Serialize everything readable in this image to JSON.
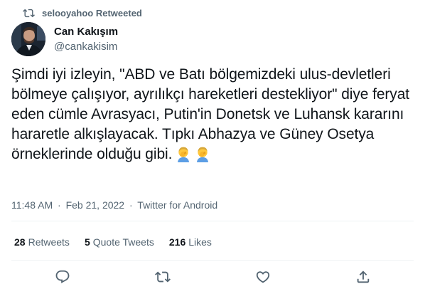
{
  "context": {
    "text": "selooyahoo Retweeted"
  },
  "author": {
    "name": "Can Kakışım",
    "handle": "@cankakisim"
  },
  "tweet": {
    "text": "Şimdi iyi izleyin, \"ABD ve Batı bölgemizdeki ulus-devletleri bölmeye çalışıyor, ayrılıkçı hareketleri destekliyor\" diye feryat eden cümle Avrasyacı, Putin'in Donetsk ve Luhansk kararını hararetle alkışlayacak. Tıpkı Abhazya ve Güney Osetya örneklerinde olduğu gibi.",
    "emojis": [
      "man-facepalming-emoji",
      "man-facepalming-emoji"
    ]
  },
  "meta": {
    "time": "11:48 AM",
    "date": "Feb 21, 2022",
    "source": "Twitter for Android",
    "separator": "·"
  },
  "stats": {
    "retweets": {
      "count": "28",
      "label": "Retweets"
    },
    "quote_tweets": {
      "count": "5",
      "label": "Quote Tweets"
    },
    "likes": {
      "count": "216",
      "label": "Likes"
    }
  },
  "actions": [
    "reply-icon",
    "retweet-icon",
    "like-icon",
    "share-icon"
  ],
  "colors": {
    "text": "#0f1419",
    "secondary": "#536471",
    "divider": "#eff3f4",
    "emoji_skin": "#ffc83d",
    "emoji_shirt": "#5c9ee5"
  }
}
